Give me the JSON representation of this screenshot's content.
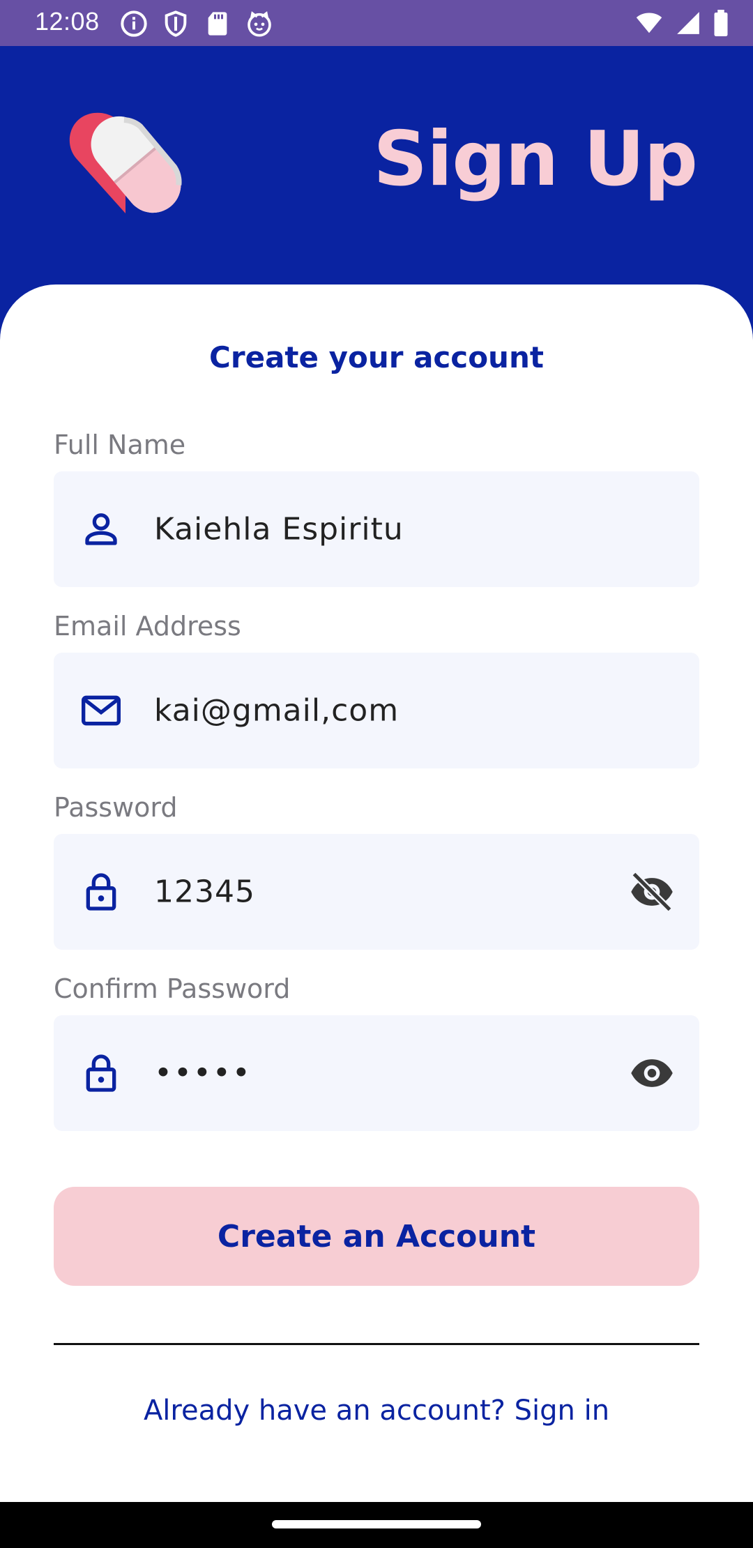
{
  "status_bar": {
    "time": "12:08",
    "left_icons": [
      "info-icon",
      "shield-icon",
      "sd-card-icon",
      "cat-face-icon"
    ],
    "right_icons": [
      "wifi-icon",
      "signal-icon",
      "battery-icon"
    ],
    "background": "#6750a4"
  },
  "header": {
    "title": "Sign Up",
    "logo": "heart-pill-logo",
    "background": "#0a23a1",
    "title_color": "#f8cdd5"
  },
  "form": {
    "heading": "Create your account",
    "full_name": {
      "label": "Full Name",
      "value": "Kaiehla Espiritu",
      "icon": "person-icon"
    },
    "email": {
      "label": "Email Address",
      "value": "kai@gmail,com",
      "icon": "mail-icon"
    },
    "password": {
      "label": "Password",
      "value": "12345",
      "icon": "lock-icon",
      "toggle_icon": "eye-off-icon"
    },
    "confirm_password": {
      "label": "Confirm Password",
      "value": "•••••",
      "icon": "lock-icon",
      "toggle_icon": "eye-icon"
    },
    "submit_label": "Create an Account",
    "signin_text": "Already have an account? Sign in"
  },
  "colors": {
    "primary": "#0a23a1",
    "accent_pink": "#f7cdd3",
    "field_bg": "#f4f6fd",
    "label_gray": "#7a7a80"
  }
}
